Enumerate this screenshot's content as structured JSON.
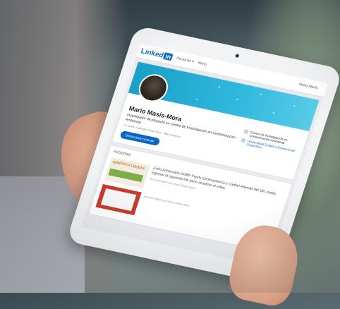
{
  "linkedin": {
    "logo_text": "Linked",
    "logo_badge": "in",
    "nav": {
      "personas": "Personas ▾",
      "mario": "Mario",
      "right_label": "Mario Masís"
    },
    "profile": {
      "name": "Mario Masís-Mora",
      "headline": "Investigador de proyecto en Centro de Investigación en Contaminación Ambiental",
      "location": "La Unión, Cartago, Costa Rica · 268 contactos",
      "connect_label": "Dense para conectar",
      "org": "Centro de Investigación en Contaminación Ambiental",
      "university": "Universidad Estatal a Distancia de Costa Rica"
    },
    "activity": {
      "title": "Actividad",
      "post1_brand": "GRIFFITH FOODS",
      "post1_text": "¡Feliz Aniversario Griffith Foods Centroamérica y Caribe! Además del QR, podés ingresar al siguiente link para visualizar el video.",
      "post1_sub": "Recomendado por Mario Masís Mora",
      "post2_text": "Recomendado por Mario Masís Mora"
    }
  },
  "colors": {
    "brand": "#0a66c2",
    "banner": "#1aa0c8"
  }
}
